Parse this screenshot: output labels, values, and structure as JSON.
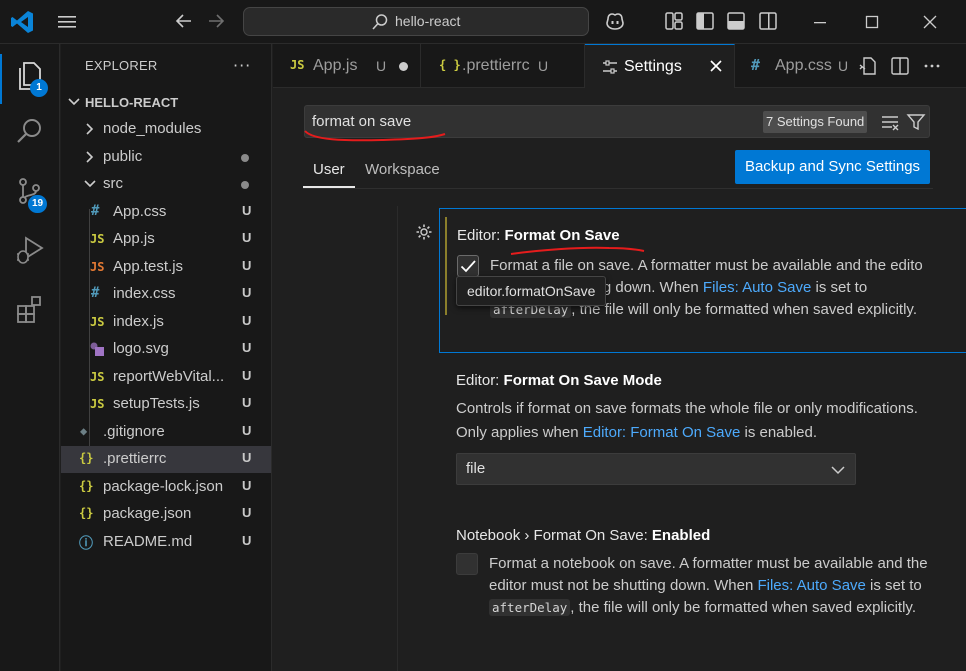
{
  "titlebar": {
    "search_text": "hello-react",
    "icons": [
      "vscode-logo-icon",
      "menu-icon",
      "back-arrow-icon",
      "forward-arrow-icon",
      "search-icon",
      "copilot-icon",
      "layout-icon",
      "toggle-sidebar-icon",
      "toggle-panel-icon",
      "toggle-secondary-sidebar-icon",
      "minimize-icon",
      "maximize-icon",
      "close-icon"
    ]
  },
  "activity": {
    "explorer_badge": "1",
    "scm_badge": "19"
  },
  "explorer": {
    "header": "EXPLORER",
    "more": "···",
    "project": "HELLO-REACT",
    "items": [
      {
        "name": "node_modules",
        "icon": "",
        "status": ""
      },
      {
        "name": "public",
        "icon": "",
        "status": ""
      },
      {
        "name": "src",
        "icon": "",
        "status": ""
      },
      {
        "name": "App.css",
        "icon": "#",
        "status": "U"
      },
      {
        "name": "App.js",
        "icon": "JS",
        "status": "U"
      },
      {
        "name": "App.test.js",
        "icon": "JS",
        "status": "U"
      },
      {
        "name": "index.css",
        "icon": "#",
        "status": "U"
      },
      {
        "name": "index.js",
        "icon": "JS",
        "status": "U"
      },
      {
        "name": "logo.svg",
        "icon": "",
        "status": "U"
      },
      {
        "name": "reportWebVital...",
        "icon": "JS",
        "status": "U"
      },
      {
        "name": "setupTests.js",
        "icon": "JS",
        "status": "U"
      },
      {
        "name": ".gitignore",
        "icon": "◆",
        "status": "U"
      },
      {
        "name": ".prettierrc",
        "icon": "{}",
        "status": "U"
      },
      {
        "name": "package-lock.json",
        "icon": "{}",
        "status": "U"
      },
      {
        "name": "package.json",
        "icon": "{}",
        "status": "U"
      },
      {
        "name": "README.md",
        "icon": "ⓘ",
        "status": "U"
      }
    ]
  },
  "tabs": [
    {
      "icon": "JS",
      "label": "App.js",
      "status": "U"
    },
    {
      "icon": "{ }",
      "label": ".prettierrc",
      "status": "U"
    },
    {
      "icon": "",
      "label": "Settings",
      "status": ""
    },
    {
      "icon": "#",
      "label": "App.css",
      "status": "U"
    }
  ],
  "settings": {
    "search_value": "format on save",
    "found": "7 Settings Found",
    "scope_user": "User",
    "scope_workspace": "Workspace",
    "backup_button": "Backup and Sync Settings",
    "s1": {
      "prefix": "Editor: ",
      "name": "Format On Save",
      "desc_line1": "Format a file on save. A formatter must be available and the edito",
      "desc_line2a": "ting down. When ",
      "desc_link": "Files: Auto Save",
      "desc_line2b": " is set to",
      "desc_code": "afterDelay",
      "desc_line3": ", the file will only be formatted when saved explicitly.",
      "tooltip": "editor.formatOnSave"
    },
    "s2": {
      "prefix": "Editor: ",
      "name": "Format On Save Mode",
      "desc_line1": "Controls if format on save formats the whole file or only modifications.",
      "desc_line2a": "Only applies when ",
      "desc_link": "Editor: Format On Save",
      "desc_line2b": " is enabled.",
      "select_value": "file"
    },
    "s3": {
      "prefix": "Notebook › Format On Save: ",
      "name": "Enabled",
      "desc_line1": "Format a notebook on save. A formatter must be available and the",
      "desc_line2a": "editor must not be shutting down. When ",
      "desc_link": "Files: Auto Save",
      "desc_line2b": " is set to",
      "desc_code": "afterDelay",
      "desc_line3": ", the file will only be formatted when saved explicitly."
    }
  },
  "colors": {
    "accent": "#0078d4",
    "link": "#4daafc",
    "annotation_red": "#e51c1c",
    "js_yellow": "#cbcb41",
    "css_blue": "#519aba",
    "json_yellow": "#cbcb41"
  }
}
